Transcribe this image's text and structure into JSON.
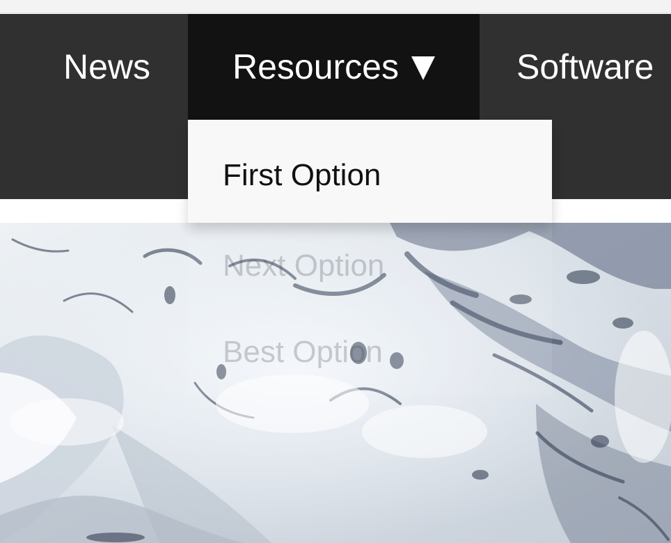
{
  "nav": {
    "items": [
      {
        "label": "News"
      },
      {
        "label": "Resources",
        "caret": "caret-down-icon"
      },
      {
        "label": "Software"
      }
    ]
  },
  "dropdown": {
    "items": [
      {
        "label": "First Option"
      },
      {
        "label": "Next Option"
      },
      {
        "label": "Best Option"
      }
    ]
  },
  "colors": {
    "navbar_bg": "#303030",
    "active_nav_bg": "#121212",
    "nav_text": "#ffffff",
    "dropdown_bg": "#f8f8f8",
    "dropdown_text": "#111111"
  }
}
